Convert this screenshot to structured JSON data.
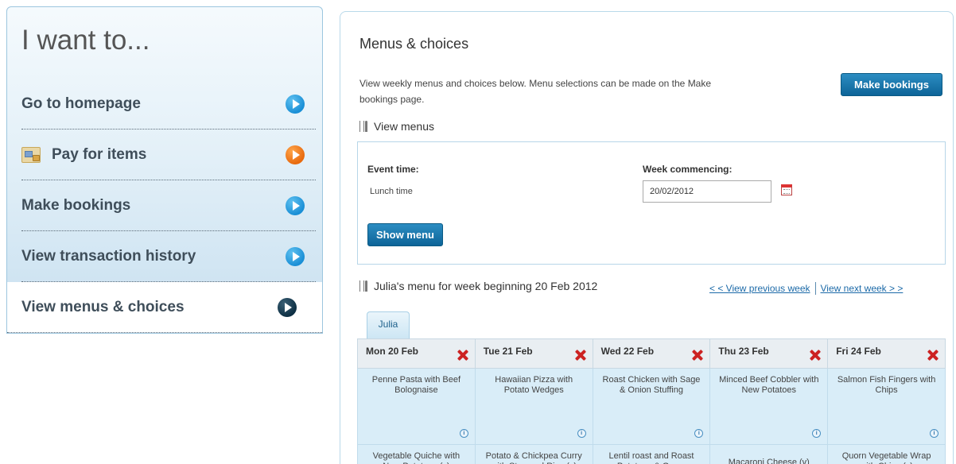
{
  "sidebar": {
    "title": "I want to...",
    "items": [
      {
        "label": "Go to homepage"
      },
      {
        "label": "Pay for items"
      },
      {
        "label": "Make bookings"
      },
      {
        "label": "View transaction history"
      },
      {
        "label": "View menus & choices"
      }
    ]
  },
  "main": {
    "title": "Menus & choices",
    "intro": "View weekly menus and choices below. Menu selections can be made on the Make bookings page.",
    "make_bookings_label": "Make bookings",
    "view_menus_heading": "View menus",
    "form": {
      "event_time_label": "Event time:",
      "event_time_value": "Lunch time",
      "week_label": "Week commencing:",
      "week_value": "20/02/2012",
      "show_menu_label": "Show menu"
    },
    "week_heading": "Julia's menu for week beginning 20 Feb 2012",
    "prev_week_label": "< < View previous week",
    "next_week_label": "View next week > >",
    "tab_label": "Julia",
    "info_glyph": "i",
    "days": [
      {
        "label": "Mon 20 Feb",
        "meal1": "Penne Pasta with Beef Bolognaise",
        "meal2": "Vegetable Quiche with New Potatoes (v)"
      },
      {
        "label": "Tue 21 Feb",
        "meal1": "Hawaiian Pizza with Potato Wedges",
        "meal2": "Potato & Chickpea Curry with Steamed Rice (v)"
      },
      {
        "label": "Wed 22 Feb",
        "meal1": "Roast Chicken with Sage & Onion Stuffing",
        "meal2": "Lentil roast and Roast Potatoes & Gravy"
      },
      {
        "label": "Thu 23 Feb",
        "meal1": "Minced Beef Cobbler with New Potatoes",
        "meal2": "Macaroni Cheese (v)"
      },
      {
        "label": "Fri 24 Feb",
        "meal1": "Salmon Fish Fingers with Chips",
        "meal2": "Quorn Vegetable Wrap with Chips (v)"
      }
    ]
  },
  "colors": {
    "accent_blue": "#1a8fd6",
    "accent_orange": "#e86a0e",
    "button_blue": "#0d6498",
    "remove_red": "#cc2222",
    "cell_blue": "#d9edf8"
  }
}
